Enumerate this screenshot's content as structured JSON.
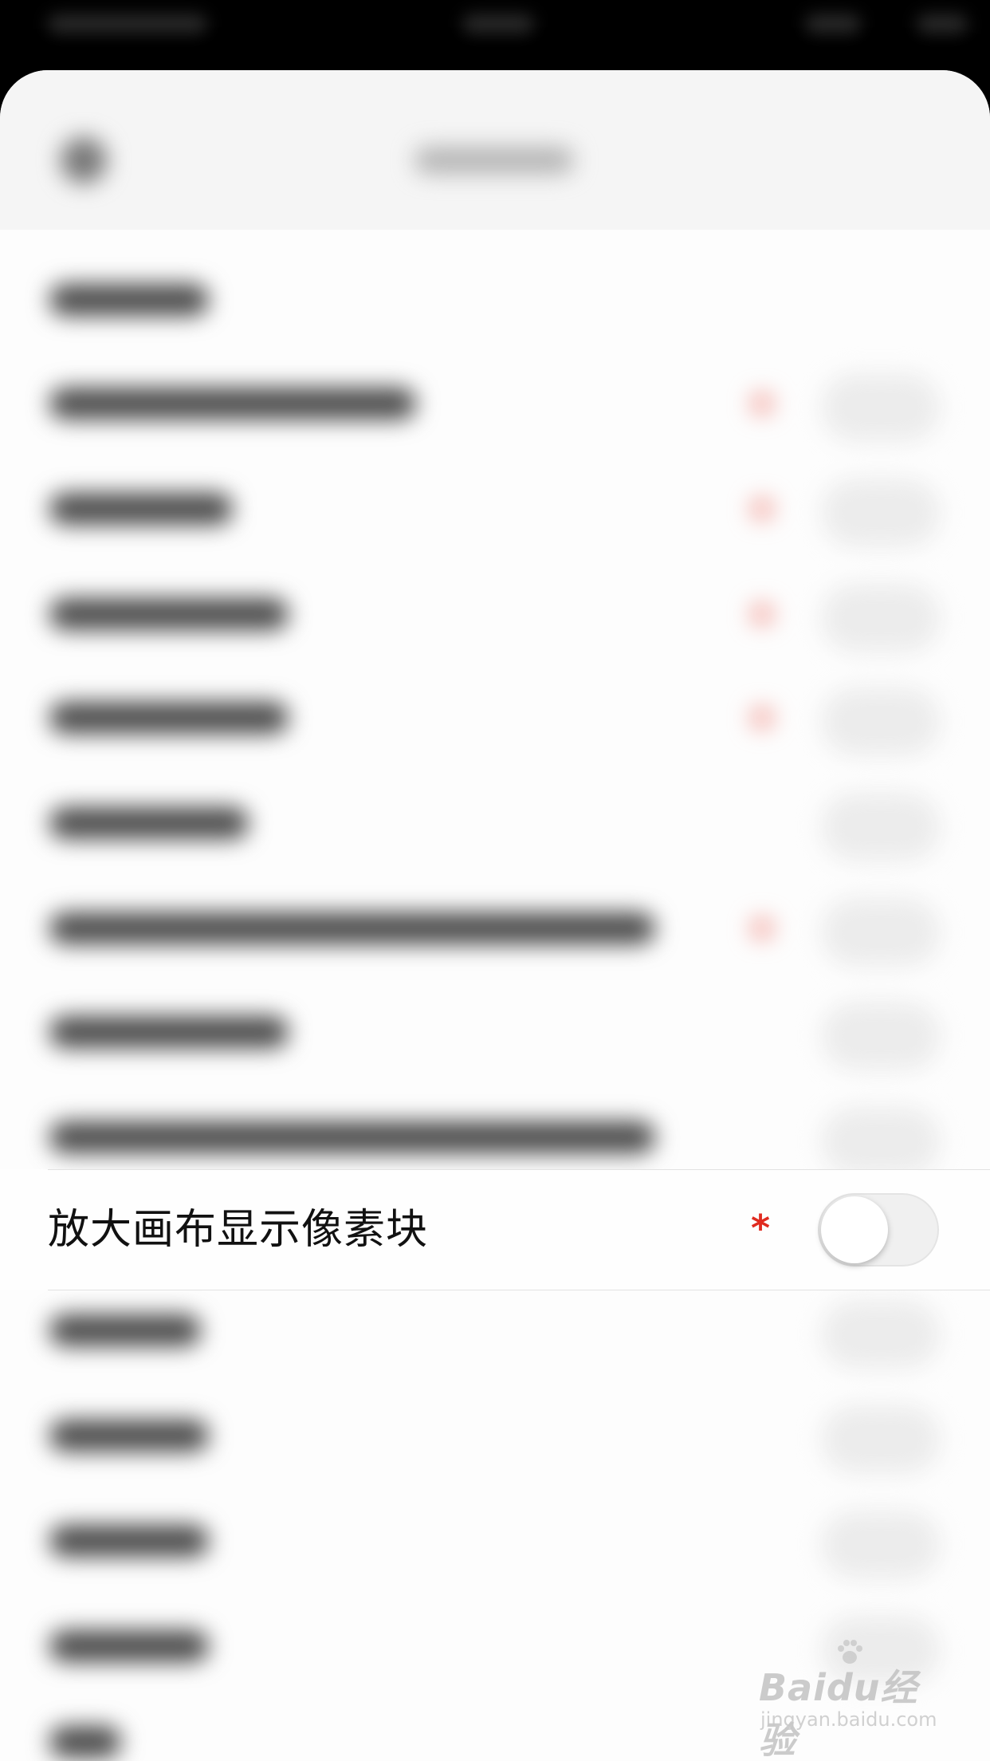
{
  "setting_row": {
    "label": "放大画布显示像素块",
    "required_mark": "*",
    "toggle_on": false
  },
  "watermark": {
    "logo_text": "Baidu经验",
    "url": "jingyan.baidu.com"
  },
  "colors": {
    "required_mark": "#e02b20",
    "toggle_track_off": "#f0f0f0",
    "background": "#fdfdfd"
  },
  "icons": {
    "back": "back-arrow-icon"
  }
}
